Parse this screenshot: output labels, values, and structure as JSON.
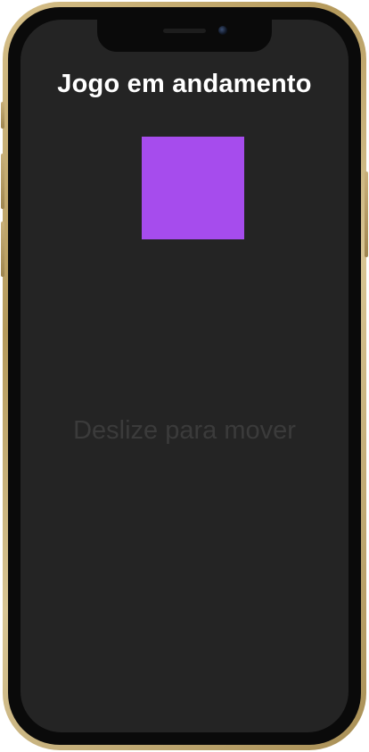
{
  "game": {
    "title": "Jogo em andamento",
    "hint": "Deslize para mover",
    "square_color": "#a64ced"
  },
  "colors": {
    "screen_background": "#242424",
    "frame": "#c8b37f",
    "title_text": "#ffffff",
    "hint_text": "#3b3b3b"
  }
}
